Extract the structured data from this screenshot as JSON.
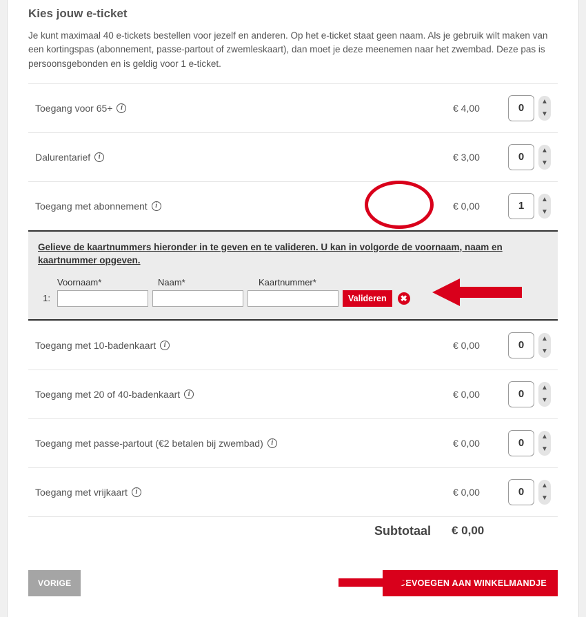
{
  "header": {
    "title": "Kies jouw e-ticket",
    "description": "Je kunt maximaal 40 e-tickets bestellen voor jezelf en anderen. Op het e-ticket staat geen naam. Als je gebruik wilt maken van een kortingspas (abonnement, passe-partout of zwemleskaart), dan moet je deze meenemen naar het zwembad. Deze pas is persoonsgebonden en is geldig voor 1 e-ticket."
  },
  "tickets": [
    {
      "label": "Toegang voor 65+",
      "price": "€ 4,00",
      "qty": "0"
    },
    {
      "label": "Dalurentarief",
      "price": "€ 3,00",
      "qty": "0"
    },
    {
      "label": "Toegang met abonnement",
      "price": "€ 0,00",
      "qty": "1"
    },
    {
      "label": "Toegang met 10-badenkaart",
      "price": "€ 0,00",
      "qty": "0"
    },
    {
      "label": "Toegang met 20 of 40-badenkaart",
      "price": "€ 0,00",
      "qty": "0"
    },
    {
      "label": "Toegang met passe-partout (€2 betalen bij zwembad)",
      "price": "€ 0,00",
      "qty": "0"
    },
    {
      "label": "Toegang met vrijkaart",
      "price": "€ 0,00",
      "qty": "0"
    }
  ],
  "validation": {
    "message": "Gelieve de kaartnummers hieronder in te geven en te valideren. U kan in volgorde de voornaam, naam en kaartnummer opgeven.",
    "field_headers": {
      "voornaam": "Voornaam*",
      "naam": "Naam*",
      "kaartnummer": "Kaartnummer*"
    },
    "rows": [
      {
        "num": "1:",
        "voornaam": "",
        "naam": "",
        "kaartnummer": ""
      }
    ],
    "validate_label": "Valideren"
  },
  "subtotal": {
    "label": "Subtotaal",
    "value": "€ 0,00"
  },
  "buttons": {
    "previous": "VORIGE",
    "add_cart": "TOEVOEGEN AAN WINKELMANDJE"
  }
}
